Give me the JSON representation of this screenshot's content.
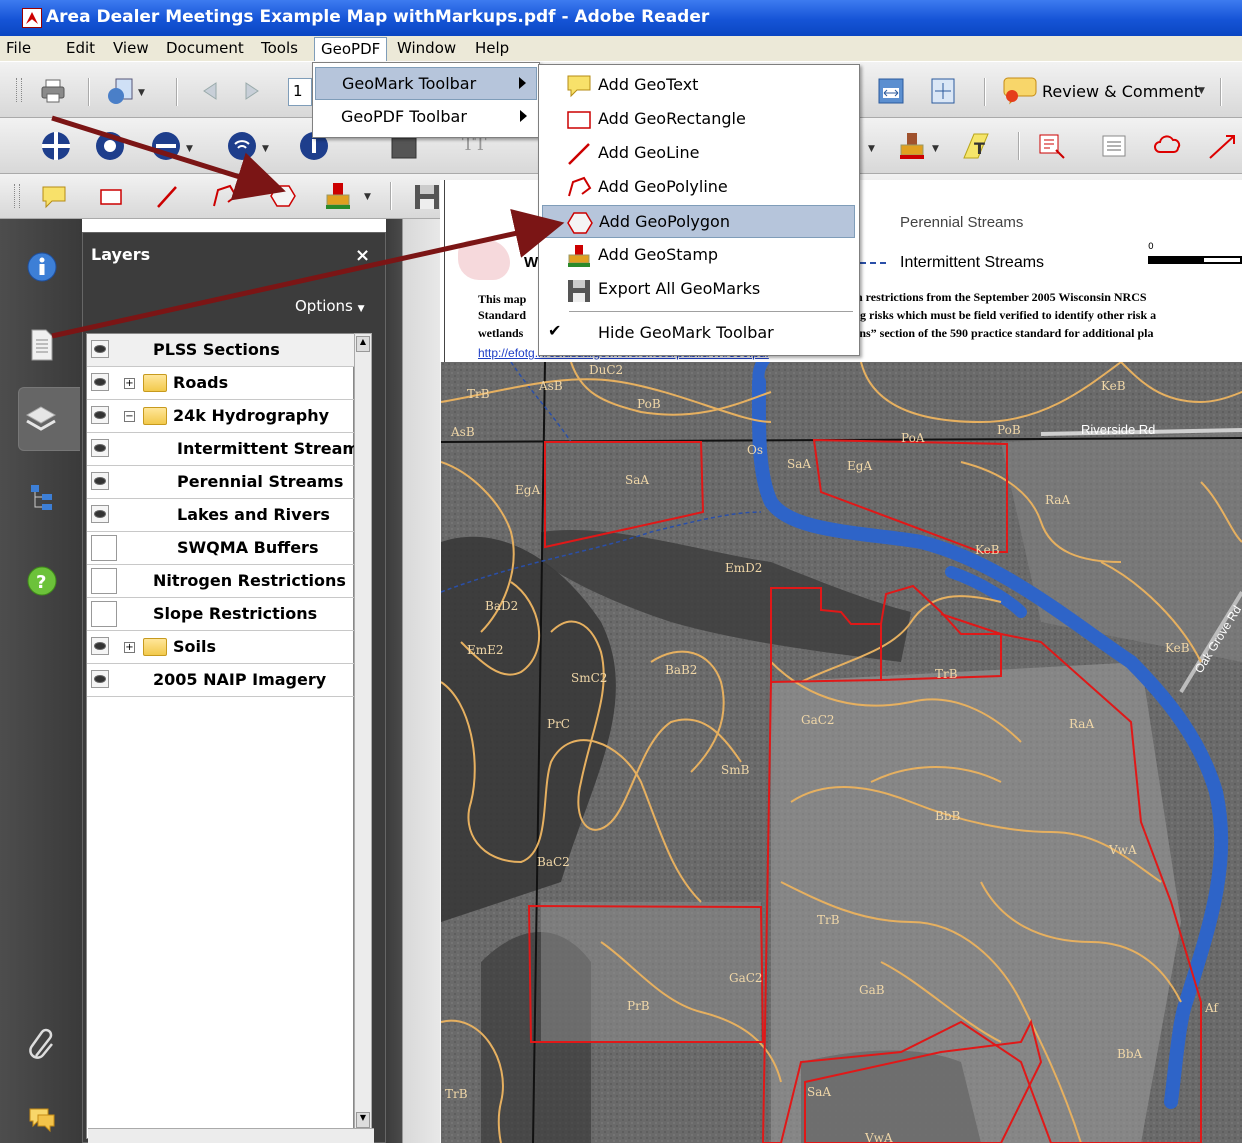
{
  "window": {
    "title": "Area Dealer Meetings Example Map withMarkups.pdf - Adobe Reader"
  },
  "menubar": [
    "File",
    "Edit",
    "View",
    "Document",
    "Tools",
    "GeoPDF",
    "Window",
    "Help"
  ],
  "toolbar": {
    "page_field": "1",
    "review_label": "Review & Comment"
  },
  "geopdf_menu": {
    "items": [
      "GeoMark Toolbar",
      "GeoPDF Toolbar"
    ]
  },
  "geomark_menu": {
    "items": [
      "Add GeoText",
      "Add GeoRectangle",
      "Add GeoLine",
      "Add GeoPolyline",
      "Add GeoPolygon",
      "Add GeoStamp",
      "Export All GeoMarks",
      "Hide GeoMark Toolbar"
    ],
    "selected": "Add GeoPolygon"
  },
  "layers": {
    "title": "Layers",
    "close": "×",
    "options": "Options",
    "rows": [
      {
        "label": "PLSS Sections",
        "visible": true
      },
      {
        "label": "Roads",
        "visible": true
      },
      {
        "label": "24k Hydrography",
        "visible": true
      },
      {
        "label": "Intermittent Streams",
        "visible": true
      },
      {
        "label": "Perennial Streams",
        "visible": true
      },
      {
        "label": "Lakes and Rivers",
        "visible": true
      },
      {
        "label": "SWQMA Buffers",
        "visible": false
      },
      {
        "label": "Nitrogen Restrictions",
        "visible": false
      },
      {
        "label": "Slope Restrictions",
        "visible": false
      },
      {
        "label": "Soils",
        "visible": true
      },
      {
        "label": "2005 NAIP Imagery",
        "visible": true
      }
    ]
  },
  "legend": {
    "perennial": "Perennial Streams",
    "intermittent": "Intermittent Streams",
    "scale": "0",
    "w": "W",
    "para": [
      "This map",
      "on restrictions from the September 2005 Wisconsin NRCS",
      "Standard",
      "ing risks which must be field verified to identify other risk a",
      "wetlands",
      "ions” section of the 590 practice standard for additional pla"
    ],
    "link": "http://efotg.nrcs.usda.gov/references/public/WI/590.pdf"
  },
  "map": {
    "road_label": "Riverside Rd",
    "road2_label": "Oak Grove Rd",
    "soil_labels": [
      "DuC2",
      "AsB",
      "TrB",
      "PoB",
      "PoA",
      "PoB",
      "KeB",
      "AsB",
      "Os",
      "SaA",
      "EgA",
      "SaA",
      "EgA",
      "RaA",
      "KeB",
      "EmD2",
      "BaD2",
      "EmE2",
      "SmC2",
      "BaB2",
      "PrC",
      "TrB",
      "GaC2",
      "RaA",
      "KeB",
      "SmB",
      "BbB",
      "VwA",
      "BaC2",
      "TrB",
      "GaC2",
      "PrB",
      "GaB",
      "Af",
      "BbA",
      "SaA",
      "VwA",
      "TrB"
    ]
  }
}
